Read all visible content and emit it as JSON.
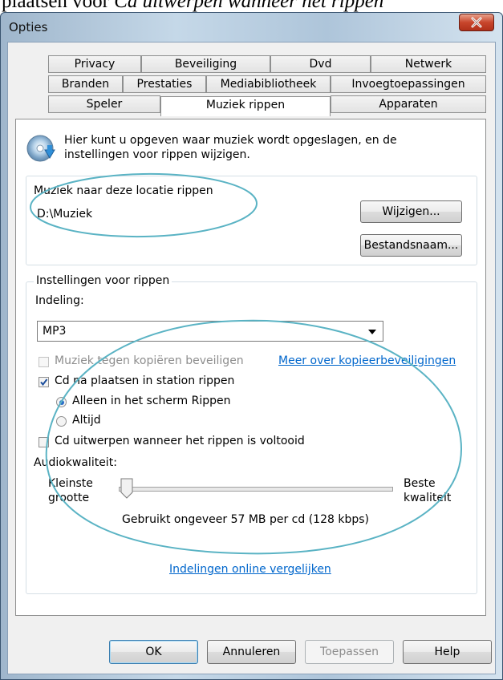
{
  "document": {
    "text_plain": "plaatsen voor ",
    "text_italic": "Cd uitwerpen wanneer het rippen"
  },
  "window": {
    "title": "Opties",
    "close_label": "x"
  },
  "tabs": {
    "row1": [
      "Privacy",
      "Beveiliging",
      "Dvd",
      "Netwerk"
    ],
    "row2": [
      "Branden",
      "Prestaties",
      "Mediabibliotheek",
      "Invoegtoepassingen"
    ],
    "row3": [
      "Speler",
      "Muziek rippen",
      "Apparaten"
    ],
    "active": "Muziek rippen"
  },
  "intro": {
    "line1": "Hier kunt u opgeven waar muziek wordt opgeslagen, en de",
    "line2": "instellingen voor rippen wijzigen."
  },
  "location": {
    "label": "Muziek naar deze locatie rippen",
    "path": "D:\\Muziek",
    "change_button": "Wijzigen...",
    "filename_button": "Bestandsnaam..."
  },
  "rip_settings": {
    "group_label": "Instellingen voor rippen",
    "format_label": "Indeling:",
    "format_value": "MP3",
    "copy_protect_label": "Muziek tegen kopiëren beveiligen",
    "copy_protect_checked": false,
    "copy_protect_link": "Meer over kopieerbeveiligingen",
    "auto_rip_label": "Cd na plaatsen in station rippen",
    "auto_rip_checked": true,
    "radio_only_rip_screen": "Alleen in het scherm Rippen",
    "radio_always": "Altijd",
    "selected_radio": "Alleen in het scherm Rippen",
    "eject_label": "Cd uitwerpen wanneer het rippen is voltooid",
    "eject_checked": false,
    "audio_quality_label": "Audiokwaliteit:",
    "slider_min_line1": "Kleinste",
    "slider_min_line2": "grootte",
    "slider_max_line1": "Beste",
    "slider_max_line2": "kwaliteit",
    "slider_position": 0,
    "usage_text": "Gebruikt ongeveer 57 MB per cd (128 kbps)",
    "compare_link": "Indelingen online vergelijken"
  },
  "footer": {
    "ok": "OK",
    "cancel": "Annuleren",
    "apply": "Toepassen",
    "help": "Help"
  },
  "colors": {
    "link": "#0066cc",
    "annotation": "#5ab3c4",
    "close_button": "#c8462c"
  }
}
